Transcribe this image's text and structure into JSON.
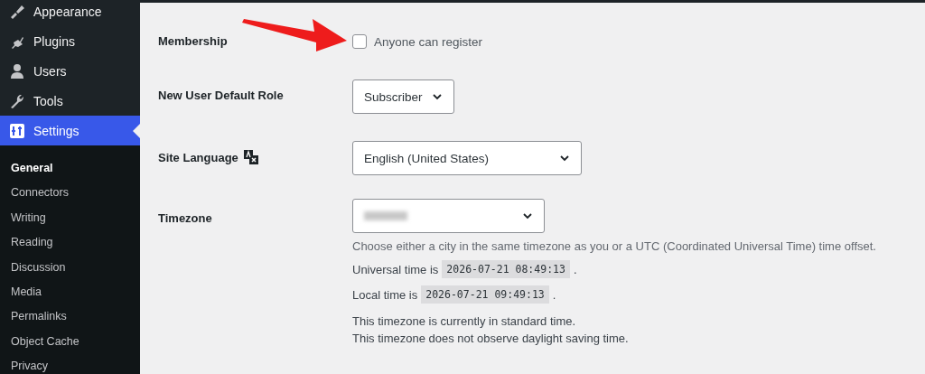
{
  "sidebar": {
    "menu": [
      {
        "label": "Appearance",
        "selected": false
      },
      {
        "label": "Plugins",
        "selected": false
      },
      {
        "label": "Users",
        "selected": false
      },
      {
        "label": "Tools",
        "selected": false
      },
      {
        "label": "Settings",
        "selected": true
      }
    ],
    "submenu": [
      {
        "label": "General",
        "selected": true
      },
      {
        "label": "Connectors",
        "selected": false
      },
      {
        "label": "Writing",
        "selected": false
      },
      {
        "label": "Reading",
        "selected": false
      },
      {
        "label": "Discussion",
        "selected": false
      },
      {
        "label": "Media",
        "selected": false
      },
      {
        "label": "Permalinks",
        "selected": false
      },
      {
        "label": "Object Cache",
        "selected": false
      },
      {
        "label": "Privacy",
        "selected": false
      }
    ]
  },
  "settings": [
    {
      "kind": "checkbox",
      "label": "Membership",
      "option": "Anyone can register",
      "checked": false
    },
    {
      "kind": "select",
      "label": "New User Default Role",
      "value": "Subscriber"
    },
    {
      "kind": "language",
      "label": "Site Language",
      "value": "English (United States)"
    },
    {
      "kind": "timezone",
      "label": "Timezone",
      "description": "Choose either a city in the same timezone as you or a UTC (Coordinated Universal Time) time offset.",
      "times": [
        {
          "prefix": "Universal time is",
          "value": "2026-07-21 08:49:13",
          "suffix": "."
        },
        {
          "prefix": "Local time is",
          "value": "2026-07-21 09:49:13",
          "suffix": "."
        }
      ],
      "notes": [
        "This timezone is currently in standard time.",
        "This timezone does not observe daylight saving time."
      ]
    }
  ]
}
